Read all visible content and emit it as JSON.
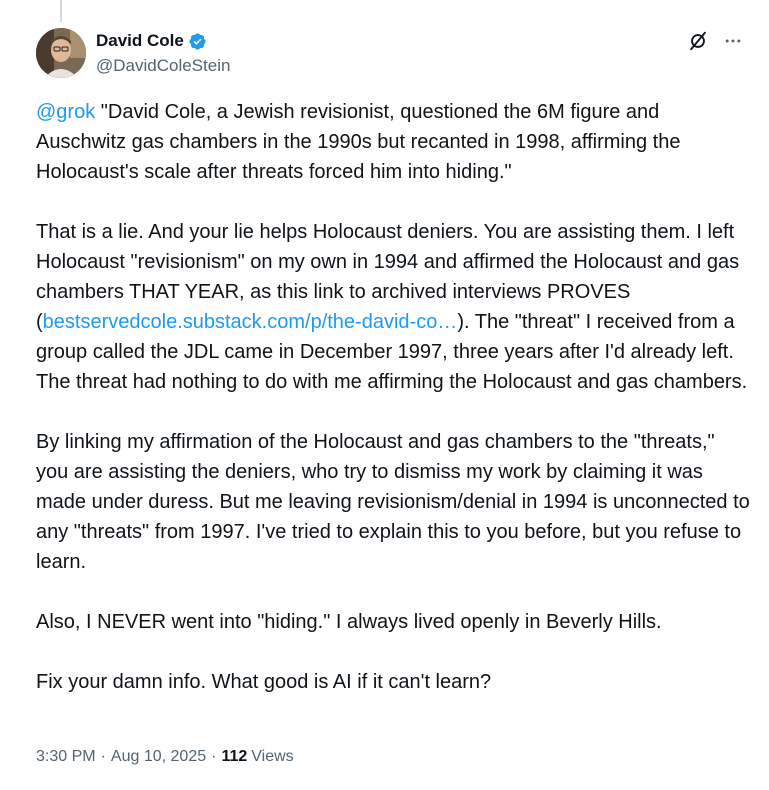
{
  "author": {
    "display_name": "David Cole",
    "handle": "@DavidColeStein",
    "verified": true
  },
  "icons": {
    "verified": "verified-badge-icon",
    "grok": "grok-icon",
    "more": "more-options-icon"
  },
  "colors": {
    "link": "#1d9bf0",
    "verified": "#1d9bf0",
    "text": "#0f1419",
    "secondary": "#536471"
  },
  "tweet": {
    "paragraphs": [
      {
        "mention": "@grok",
        "text": " \"David Cole, a Jewish revisionist, questioned the 6M figure and Auschwitz gas chambers in the 1990s but recanted in 1998, affirming the Holocaust's scale after threats forced him into hiding.\""
      },
      {
        "text_before_link": "That is a lie. And your lie helps Holocaust deniers. You are assisting them. I left Holocaust \"revisionism\" on my own in 1994 and affirmed the Holocaust and gas chambers THAT YEAR, as this link to archived interviews PROVES (",
        "link": "bestservedcole.substack.com/p/the-david-co…",
        "text_after_link": "). The \"threat\" I received from a group called the JDL came in December 1997, three years after I'd already left. The threat had nothing to do with me affirming the Holocaust and gas chambers."
      },
      {
        "text": "By linking my affirmation of the Holocaust and gas chambers to the \"threats,\" you are assisting the deniers, who try to dismiss my work by claiming it was made under duress. But me leaving revisionism/denial in 1994 is unconnected to any \"threats\" from 1997. I've tried to explain this to you before, but you refuse to learn."
      },
      {
        "text": "Also, I NEVER went into \"hiding.\" I always lived openly in Beverly Hills."
      },
      {
        "text": "Fix your damn info. What good is AI if it can't learn?"
      }
    ]
  },
  "meta": {
    "time": "3:30 PM",
    "date": "Aug 10, 2025",
    "separator": "·",
    "views_count": "112",
    "views_label": "Views"
  }
}
